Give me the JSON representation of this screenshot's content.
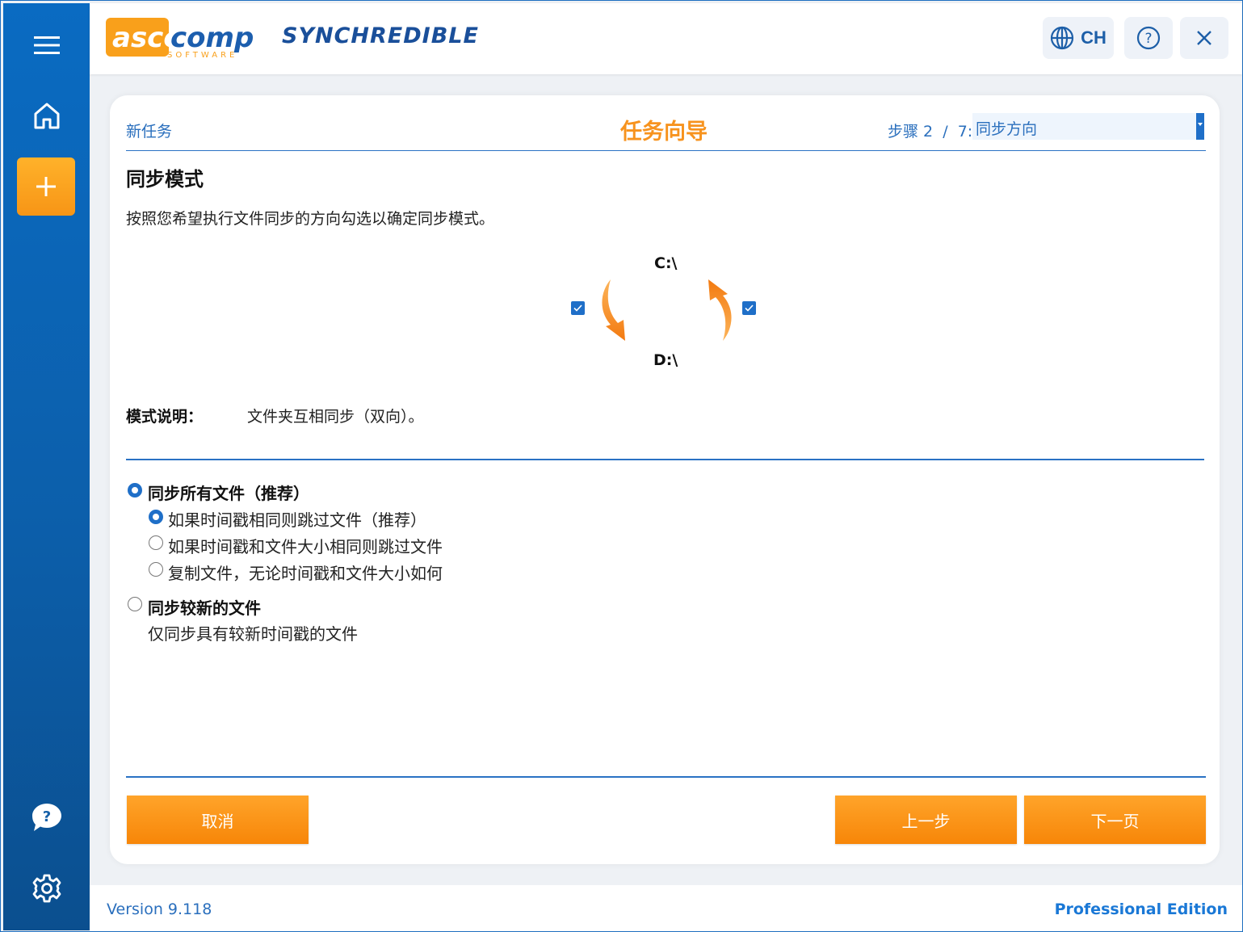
{
  "app": {
    "logo_text": "ascomp",
    "logo_subtext": "SOFTWARE",
    "product_name": "SYNCHREDIBLE"
  },
  "header": {
    "language_label": "CH",
    "language_icon": "globe-icon",
    "help_icon": "help-circle-icon",
    "close_icon": "close-icon"
  },
  "sidebar": {
    "menu_icon": "hamburger-menu-icon",
    "home_icon": "home-icon",
    "add_icon": "plus-icon",
    "chat_help_icon": "chat-help-icon",
    "settings_icon": "gear-icon"
  },
  "wizard": {
    "breadcrumb": "新任务",
    "title": "任务向导",
    "step_label": "步骤 2  /  7:",
    "step_value": "同步方向"
  },
  "section": {
    "heading": "同步模式",
    "instruction": "按照您希望执行文件同步的方向勾选以确定同步模式。"
  },
  "diagram": {
    "top_drive": "C:\\",
    "bottom_drive": "D:\\",
    "left_direction_checked": true,
    "right_direction_checked": true
  },
  "mode_description": {
    "label": "模式说明：",
    "text": "文件夹互相同步（双向）。"
  },
  "options": {
    "sync_all": {
      "label": "同步所有文件（推荐）",
      "selected": true,
      "sub_options": [
        {
          "label": "如果时间戳相同则跳过文件（推荐）",
          "selected": true
        },
        {
          "label": "如果时间戳和文件大小相同则跳过文件",
          "selected": false
        },
        {
          "label": "复制文件，无论时间戳和文件大小如何",
          "selected": false
        }
      ]
    },
    "sync_newer": {
      "label": "同步较新的文件",
      "selected": false,
      "description": "仅同步具有较新时间戳的文件"
    }
  },
  "buttons": {
    "cancel": "取消",
    "back": "上一步",
    "next": "下一页"
  },
  "footer": {
    "version": "Version 9.118",
    "edition": "Professional Edition"
  },
  "colors": {
    "primary_blue": "#1f6fc8",
    "accent_orange": "#f78608",
    "title_orange": "#f7931e"
  }
}
